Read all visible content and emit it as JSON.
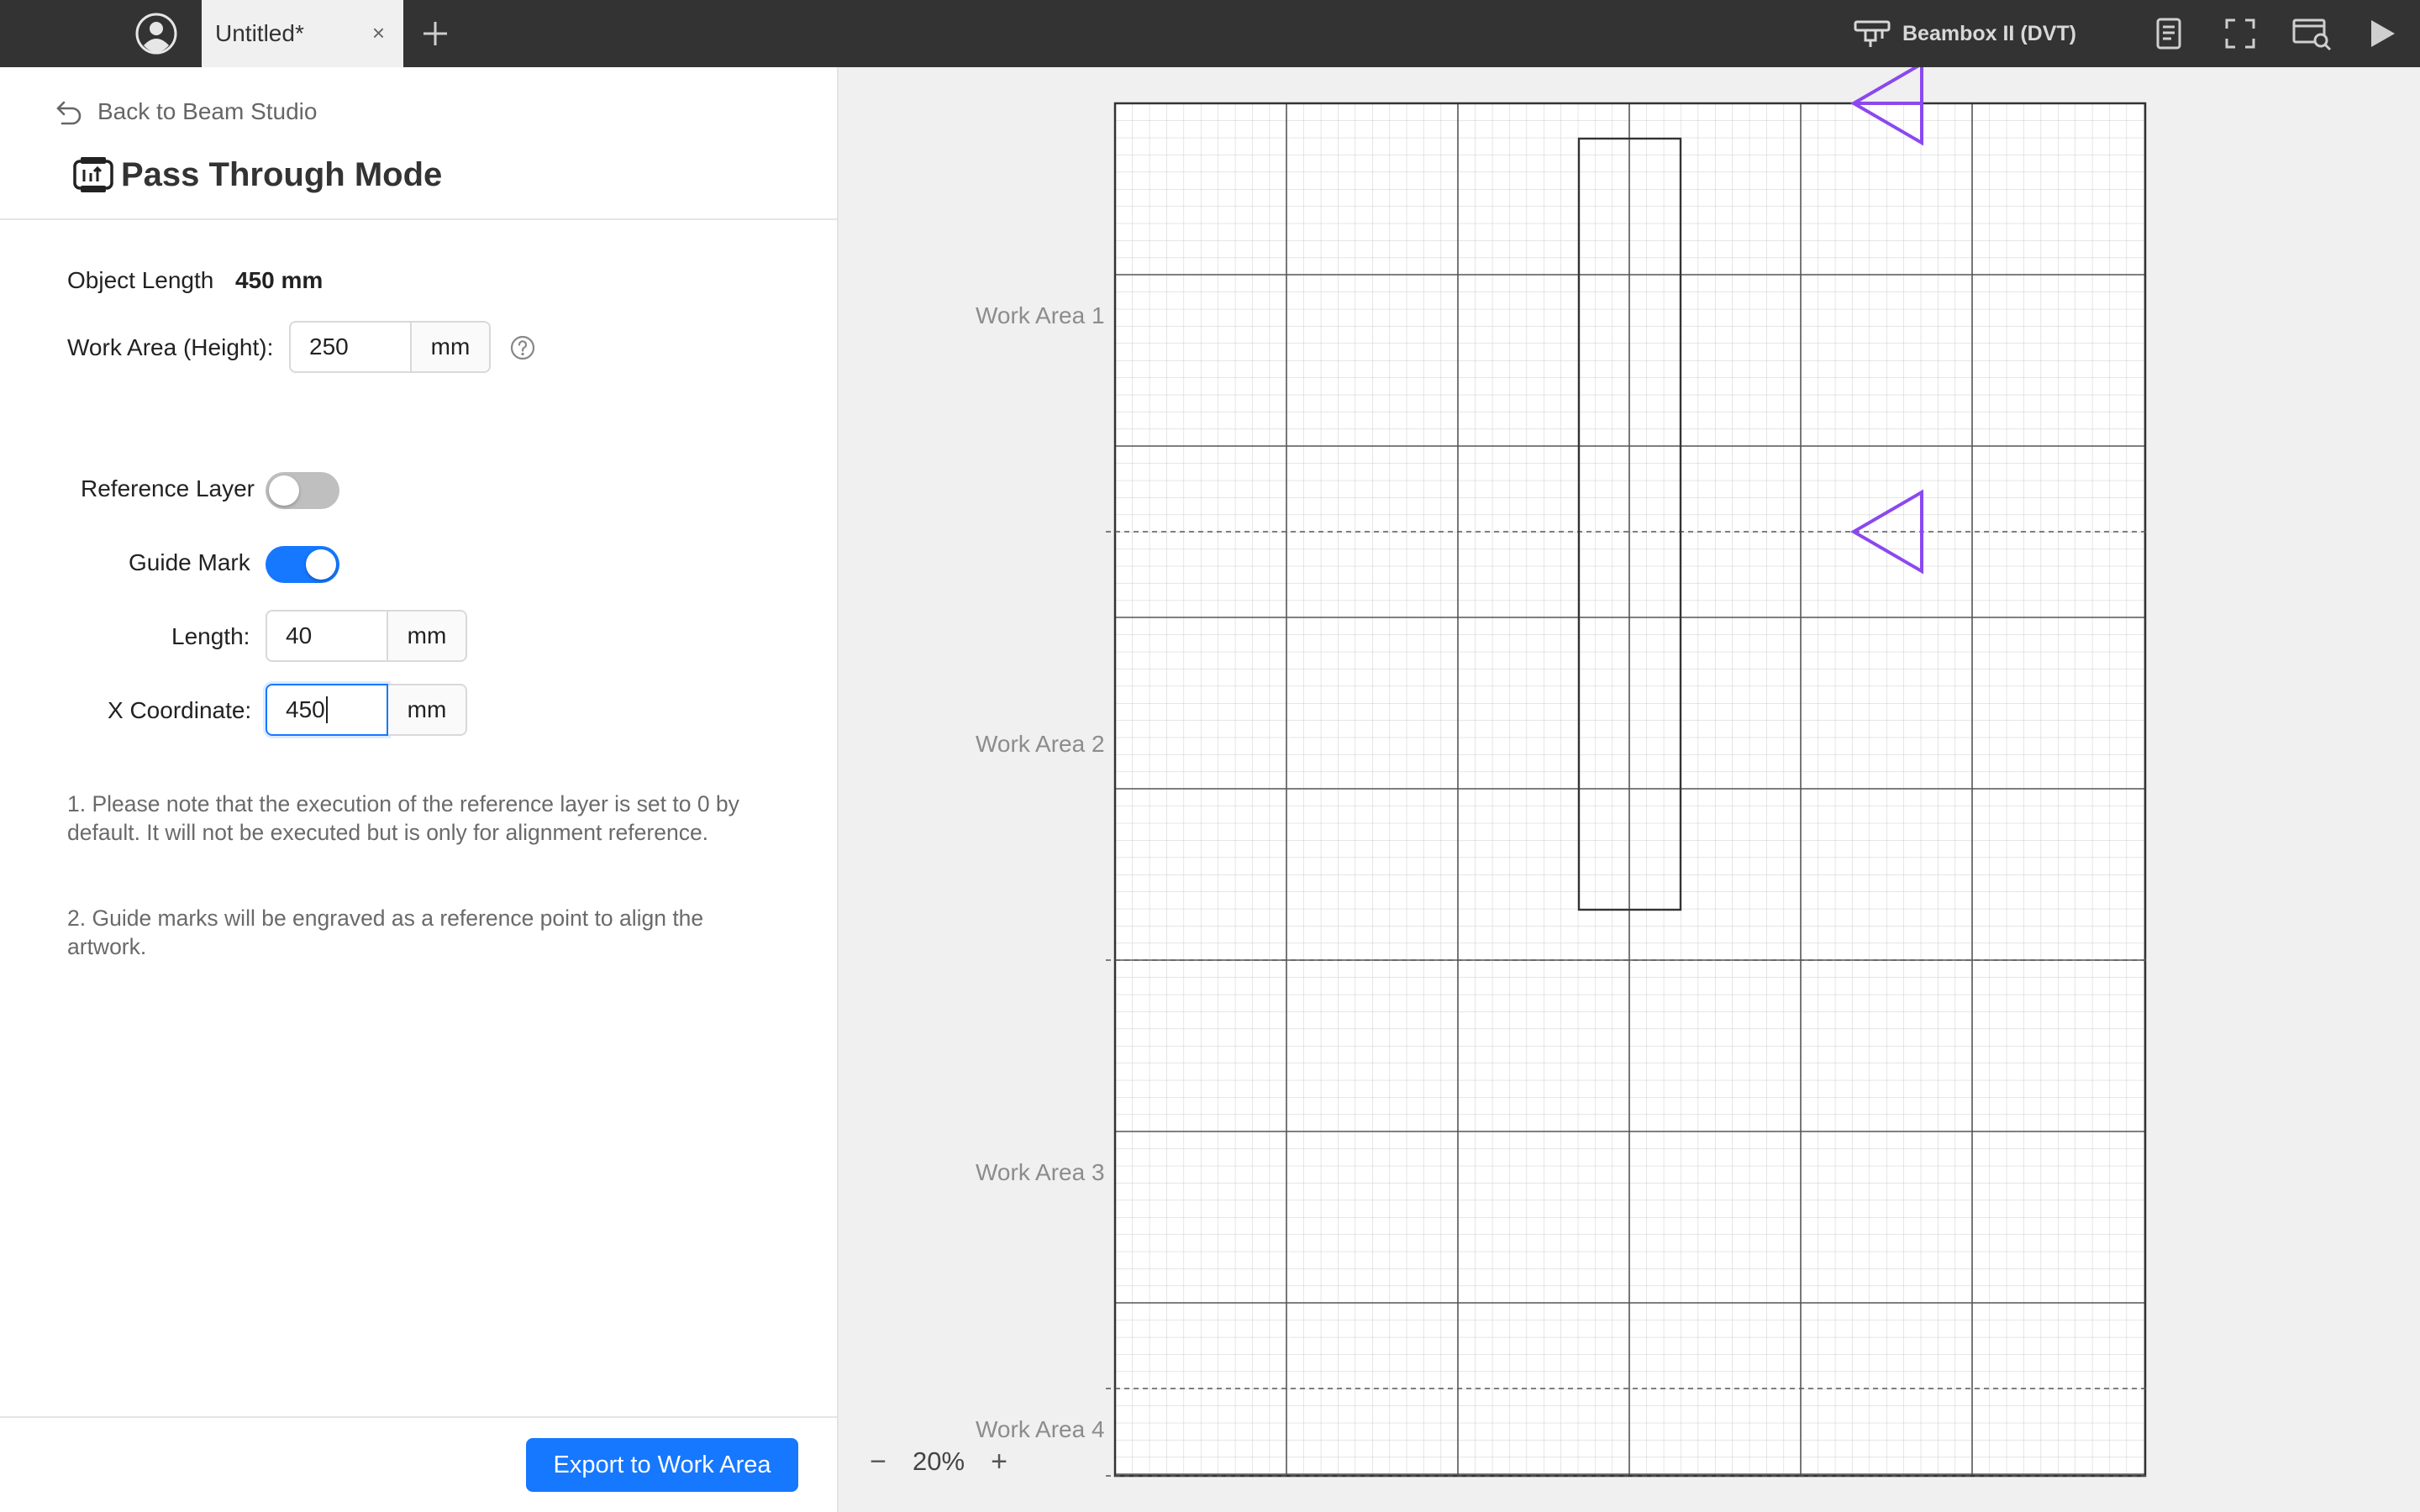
{
  "titlebar": {
    "tab_title": "Untitled*",
    "tab_close": "×",
    "device_name": "Beambox II (DVT)"
  },
  "panel": {
    "back_label": "Back to Beam Studio",
    "title": "Pass Through Mode",
    "object_length_label": "Object Length",
    "object_length_value": "450 mm",
    "work_area_label": "Work Area (Height):",
    "work_area_value": "250",
    "work_area_unit": "mm",
    "reference_layer_label": "Reference Layer",
    "reference_layer_on": false,
    "guide_mark_label": "Guide Mark",
    "guide_mark_on": true,
    "length_label": "Length:",
    "length_value": "40",
    "length_unit": "mm",
    "x_coord_label": "X Coordinate:",
    "x_coord_value": "450",
    "x_coord_unit": "mm",
    "note_1": "1. Please note that the execution of the reference layer is set to 0 by default. It will not be executed but is only for alignment reference.",
    "note_2": "2. Guide marks will be engraved as a reference point to align the artwork.",
    "export_label": "Export to Work Area"
  },
  "canvas": {
    "work_areas": [
      "Work Area 1",
      "Work Area 2",
      "Work Area 3",
      "Work Area 4"
    ],
    "zoom_out": "−",
    "zoom_value": "20%",
    "zoom_in": "+",
    "guide_mark_color": "#8b48f0",
    "grid_color_minor": "#c8c8c8",
    "grid_color_major": "#555555"
  },
  "colors": {
    "accent": "#1677ff",
    "topbar": "#333333"
  }
}
